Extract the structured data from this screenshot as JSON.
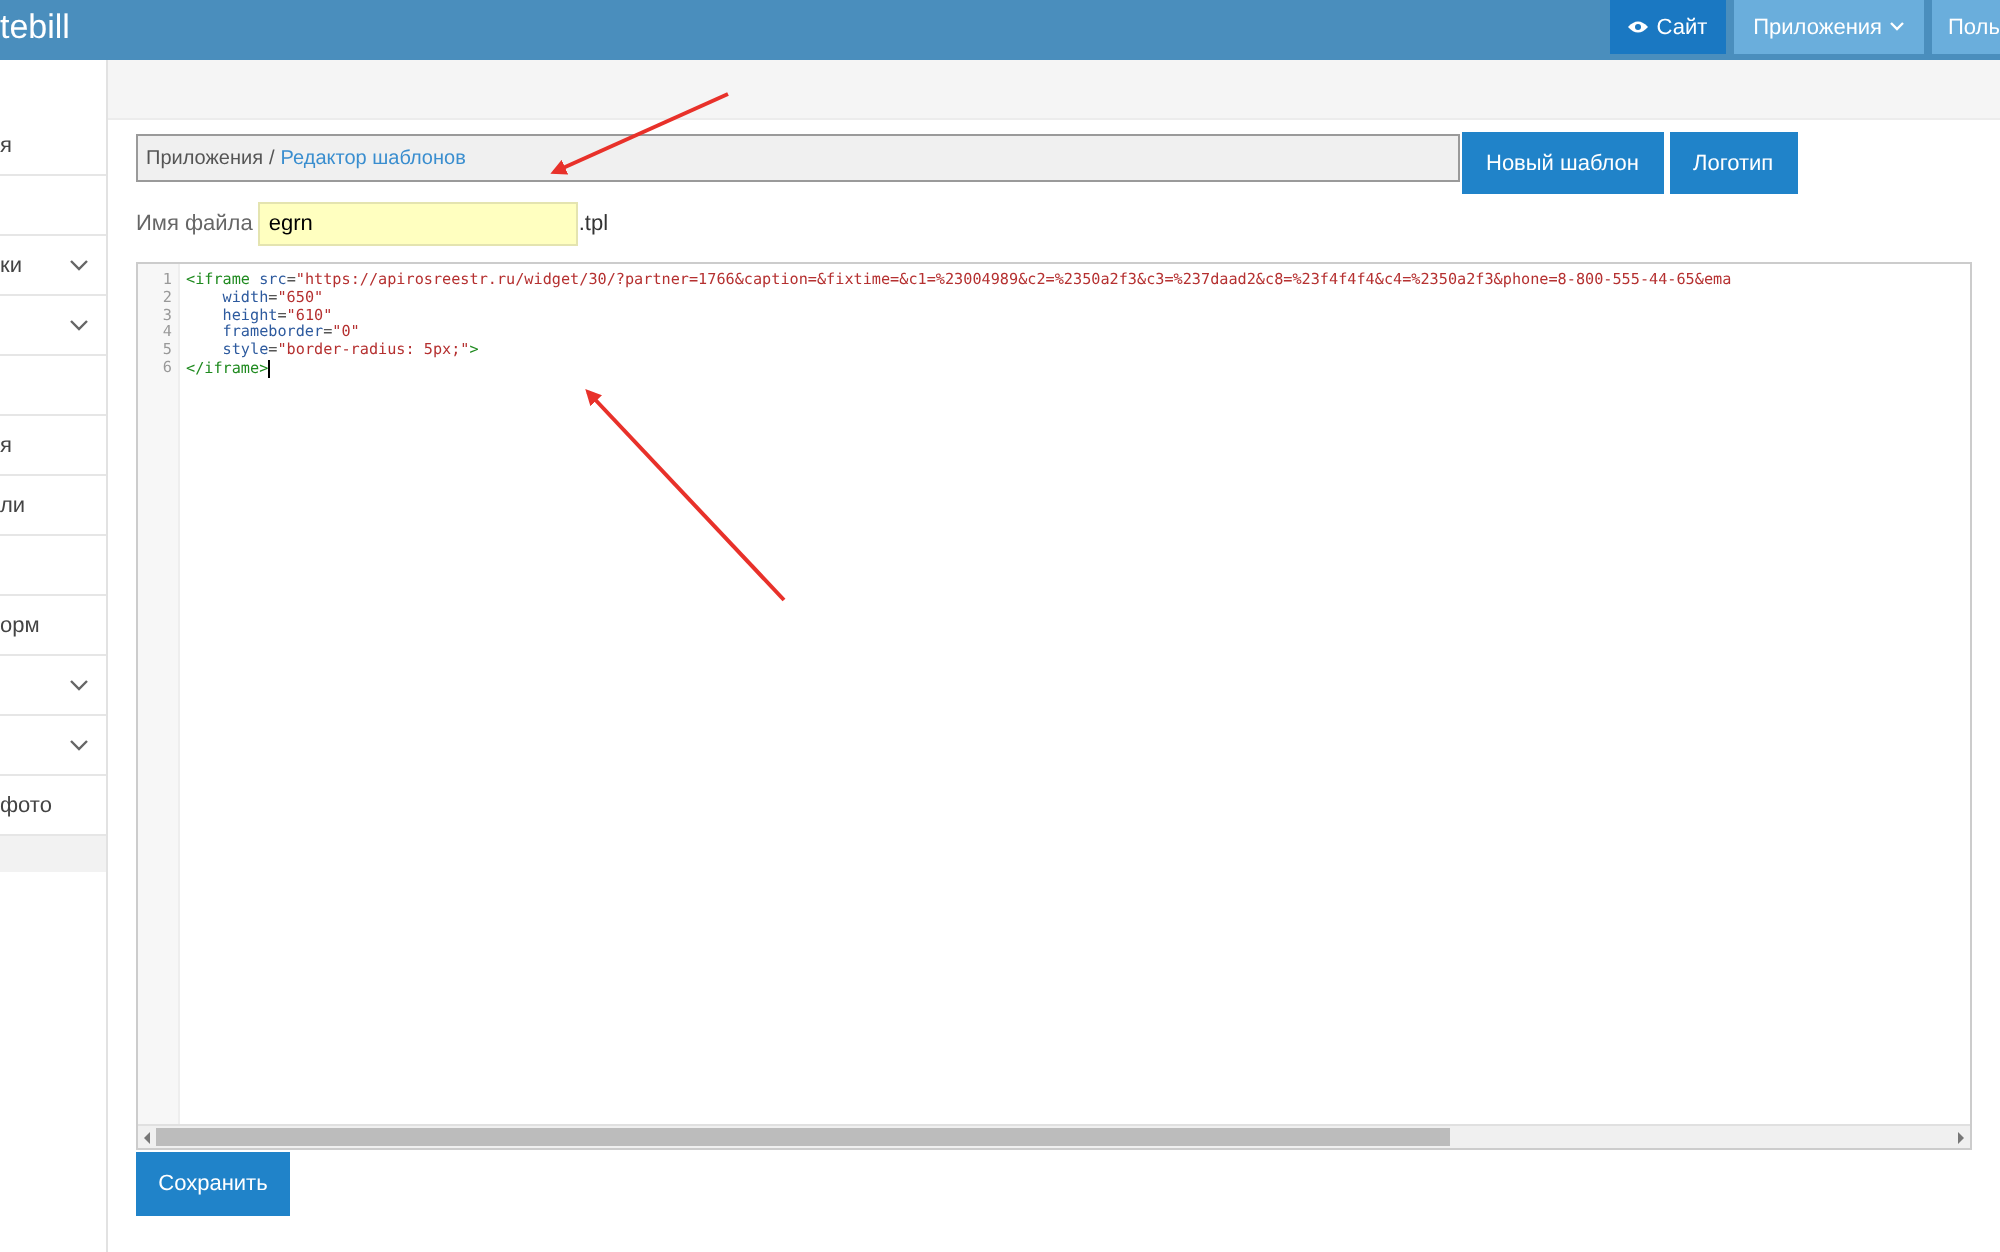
{
  "header": {
    "brand": "tebill",
    "buttons": [
      {
        "label": "Сайт",
        "kind": "site"
      },
      {
        "label": "Приложения",
        "kind": "dropdown"
      },
      {
        "label": "Поль",
        "kind": "plain"
      }
    ]
  },
  "sidebar": {
    "items": [
      {
        "label": "я",
        "expandable": false
      },
      {
        "expandable": false
      },
      {
        "label": "ки",
        "expandable": true
      },
      {
        "expandable": true
      },
      {
        "expandable": false
      },
      {
        "label": "я",
        "expandable": false
      },
      {
        "label": "ли",
        "expandable": false
      },
      {
        "expandable": false
      },
      {
        "label": "орм",
        "expandable": false
      },
      {
        "expandable": true
      },
      {
        "expandable": true
      },
      {
        "label": "фото",
        "expandable": false
      }
    ]
  },
  "breadcrumb": [
    {
      "label": "Приложения",
      "link": false
    },
    {
      "label": "/",
      "link": false
    },
    {
      "label": "Редактор шаблонов",
      "link": true
    }
  ],
  "actions": [
    "Новый шаблон",
    "Логотип"
  ],
  "filename": {
    "label": "Имя файла",
    "value": "egrn",
    "suffix": ".tpl"
  },
  "editor": {
    "lines": [
      {
        "number": "1",
        "tokens": [
          {
            "kind": "tag",
            "text": "<iframe"
          },
          {
            "kind": "attr",
            "text": " src"
          },
          {
            "kind": "punct",
            "text": "="
          },
          {
            "kind": "value",
            "text": "\"https://apirosreestr.ru/widget/30/?partner=1766&caption=&fixtime=&c1=%23004989&c2=%2350a2f3&c3=%237daad2&c8=%23f4f4f4&c4=%2350a2f3&phone=8-800-555-44-65&ema"
          }
        ]
      },
      {
        "number": "2",
        "tokens": [
          {
            "kind": "attr",
            "text": "    width"
          },
          {
            "kind": "punct",
            "text": "="
          },
          {
            "kind": "value",
            "text": "\"650\""
          }
        ]
      },
      {
        "number": "3",
        "tokens": [
          {
            "kind": "attr",
            "text": "    height"
          },
          {
            "kind": "punct",
            "text": "="
          },
          {
            "kind": "value",
            "text": "\"610\""
          }
        ]
      },
      {
        "number": "4",
        "tokens": [
          {
            "kind": "attr",
            "text": "    frameborder"
          },
          {
            "kind": "punct",
            "text": "="
          },
          {
            "kind": "value",
            "text": "\"0\""
          }
        ]
      },
      {
        "number": "5",
        "tokens": [
          {
            "kind": "attr",
            "text": "    style"
          },
          {
            "kind": "punct",
            "text": "="
          },
          {
            "kind": "value",
            "text": "\"border-radius: 5px;\""
          },
          {
            "kind": "tag",
            "text": ">"
          }
        ]
      },
      {
        "number": "6",
        "tokens": [
          {
            "kind": "tag",
            "text": "</iframe>"
          }
        ]
      }
    ]
  },
  "save_button": "Сохранить"
}
